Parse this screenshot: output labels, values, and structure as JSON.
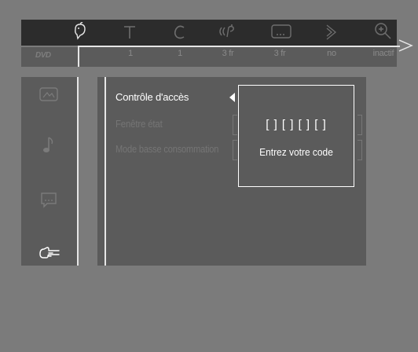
{
  "topbar": {
    "icons": [
      "parental-icon",
      "title-icon",
      "chapter-icon",
      "audio-icon",
      "subtitle-icon",
      "angle-icon",
      "zoom-icon"
    ],
    "values": {
      "disc_label": "DVD",
      "title": "1",
      "chapter": "1",
      "audio": "3 fr",
      "subtitle": "3 fr",
      "angle": "no",
      "zoom": "inactif"
    }
  },
  "sidebar": {
    "icons": [
      "picture-icon",
      "music-note-icon",
      "speech-bubble-icon",
      "hand-pointer-icon"
    ],
    "selected": "hand-pointer-icon"
  },
  "menu": {
    "items": [
      {
        "label": "Contrôle d'accès",
        "selected": true
      },
      {
        "label": "Fenêtre état",
        "selected": false
      },
      {
        "label": "Mode basse consommation",
        "selected": false
      }
    ]
  },
  "dialog": {
    "code": "[ ] [ ] [ ] [ ]",
    "prompt": "Entrez votre code"
  },
  "colors": {
    "background": "#7b7b7b",
    "panel": "#5b5b5b",
    "topbar": "#2c2c2c",
    "highlight": "#ffffff",
    "disabled": "#757575"
  }
}
